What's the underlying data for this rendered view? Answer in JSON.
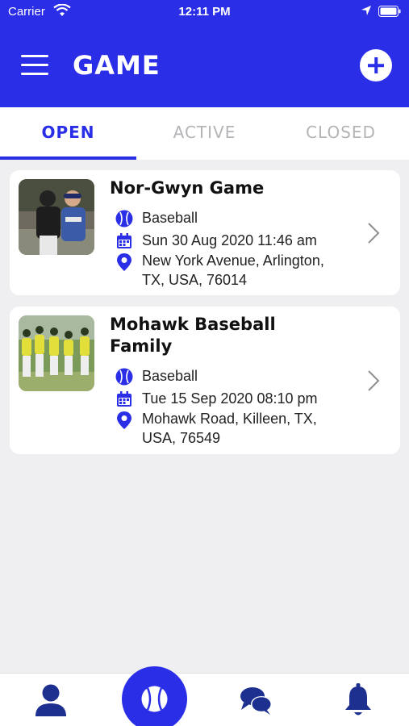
{
  "status_bar": {
    "carrier": "Carrier",
    "time": "12:11 PM"
  },
  "header": {
    "title": "GAME"
  },
  "tabs": [
    {
      "label": "OPEN",
      "active": true
    },
    {
      "label": "ACTIVE",
      "active": false
    },
    {
      "label": "CLOSED",
      "active": false
    }
  ],
  "games": [
    {
      "title": "Nor-Gwyn Game",
      "sport": "Baseball",
      "datetime": "Sun 30 Aug 2020 11:46 am",
      "address_line1": "New York Avenue, Arlington,",
      "address_line2": "TX, USA, 76014"
    },
    {
      "title_line1": "Mohawk Baseball",
      "title_line2": "Family",
      "sport": "Baseball",
      "datetime": "Tue 15 Sep 2020 08:10 pm",
      "address_line1": "Mohawk Road, Killeen, TX,",
      "address_line2": "USA, 76549"
    }
  ],
  "colors": {
    "brand": "#2a2ee6",
    "background": "#efeff2"
  },
  "icons": {
    "menu": "hamburger-icon",
    "add": "plus-circle-icon",
    "sport": "baseball-icon",
    "date": "calendar-icon",
    "location": "map-pin-icon",
    "chevron": "chevron-right-icon",
    "nav": [
      "profile-icon",
      "baseball-icon",
      "chat-icon",
      "bell-icon"
    ]
  }
}
